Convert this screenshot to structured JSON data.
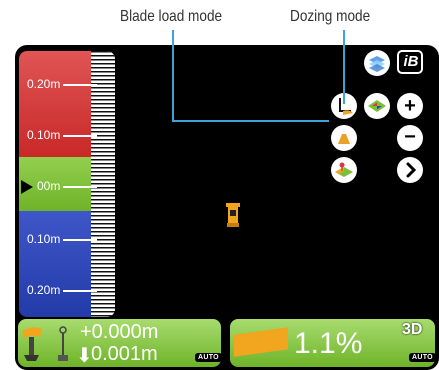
{
  "callouts": {
    "blade_load_mode": "Blade load mode",
    "dozing_mode": "Dozing mode"
  },
  "scale": {
    "labels": [
      "0.20m",
      "0.10m",
      "00m",
      "0.10m",
      "0.20m"
    ],
    "colors": {
      "above": "#d43a3a",
      "on_grade": "#7dbf3b",
      "below": "#2f47b8"
    }
  },
  "icons": {
    "ib_badge": "iB",
    "layers": "layers-icon",
    "blade_load": "blade-load-icon",
    "surface_color": "surface-color-icon",
    "zoom_in": "zoom-in-icon",
    "dozing_mode": "dozing-mode-icon",
    "zoom_out": "zoom-out-icon",
    "design_surface": "design-surface-icon",
    "next": "chevron-right-icon"
  },
  "status": {
    "elevation_offset": "+0.000m",
    "cut_fill": "0.001m",
    "slope": "1.1%",
    "mode_badge": "3D",
    "auto_label": "AUTO"
  }
}
